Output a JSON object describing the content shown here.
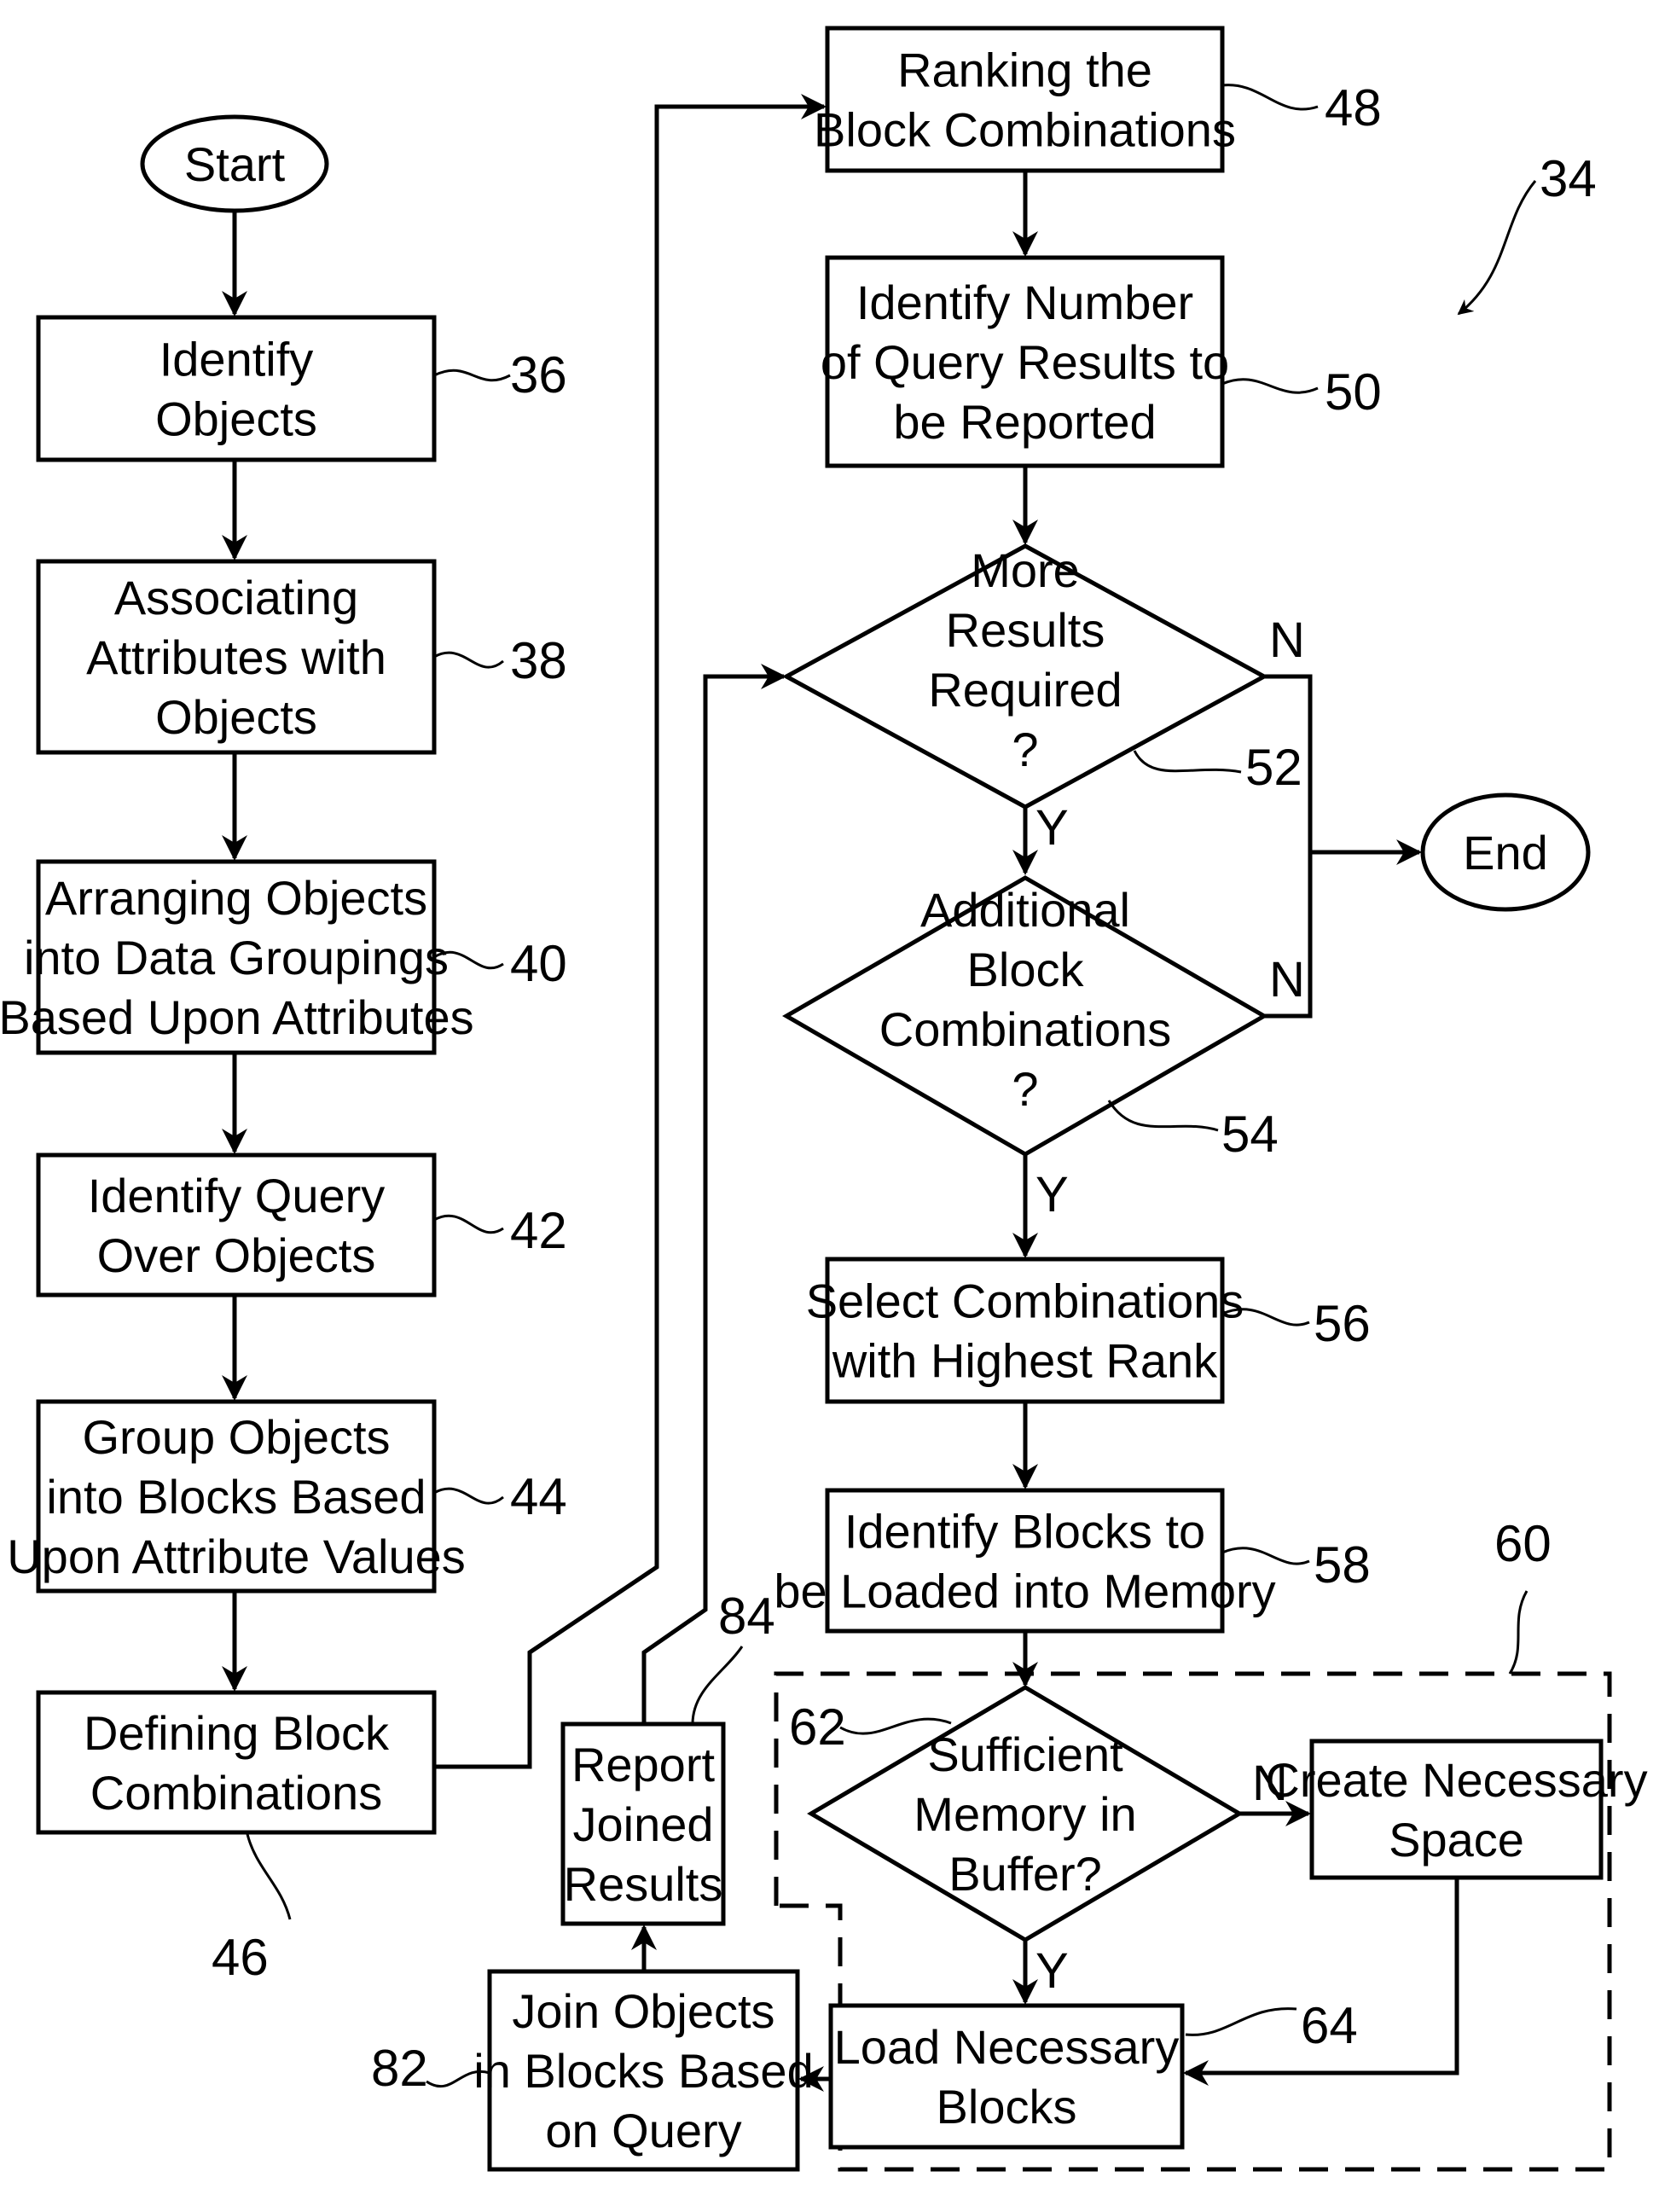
{
  "figure": {
    "ref": "34",
    "start": "Start",
    "end": "End",
    "steps": {
      "s36": {
        "ref": "36",
        "lines": [
          "Identify",
          "Objects"
        ]
      },
      "s38": {
        "ref": "38",
        "lines": [
          "Associating",
          "Attributes with",
          "Objects"
        ]
      },
      "s40": {
        "ref": "40",
        "lines": [
          "Arranging Objects",
          "into Data Groupings",
          "Based Upon Attributes"
        ]
      },
      "s42": {
        "ref": "42",
        "lines": [
          "Identify Query",
          "Over Objects"
        ]
      },
      "s44": {
        "ref": "44",
        "lines": [
          "Group Objects",
          "into Blocks Based",
          "Upon Attribute Values"
        ]
      },
      "s46": {
        "ref": "46",
        "lines": [
          "Defining Block",
          "Combinations"
        ]
      },
      "s48": {
        "ref": "48",
        "lines": [
          "Ranking the",
          "Block Combinations"
        ]
      },
      "s50": {
        "ref": "50",
        "lines": [
          "Identify Number",
          "of Query Results to",
          "be Reported"
        ]
      },
      "s56": {
        "ref": "56",
        "lines": [
          "Select Combinations",
          "with Highest Rank"
        ]
      },
      "s58": {
        "ref": "58",
        "lines": [
          "Identify Blocks to",
          "be Loaded into Memory"
        ]
      },
      "s64": {
        "ref": "64",
        "lines": [
          "Load Necessary",
          "Blocks"
        ]
      },
      "create": {
        "lines": [
          "Create Necessary",
          "Space"
        ]
      },
      "s82": {
        "ref": "82",
        "lines": [
          "Join Objects",
          "in Blocks Based",
          "on Query"
        ]
      },
      "s84": {
        "ref": "84",
        "lines": [
          "Report",
          "Joined",
          "Results"
        ]
      }
    },
    "decisions": {
      "d52": {
        "ref": "52",
        "lines": [
          "More",
          "Results",
          "Required",
          "?"
        ],
        "yes": "Y",
        "no": "N"
      },
      "d54": {
        "ref": "54",
        "lines": [
          "Additional",
          "Block",
          "Combinations",
          "?"
        ],
        "yes": "Y",
        "no": "N"
      },
      "d62": {
        "ref": "62",
        "lines": [
          "Sufficient",
          "Memory in",
          "Buffer?"
        ],
        "yes": "Y",
        "no": "N"
      }
    },
    "group": {
      "ref": "60"
    }
  }
}
